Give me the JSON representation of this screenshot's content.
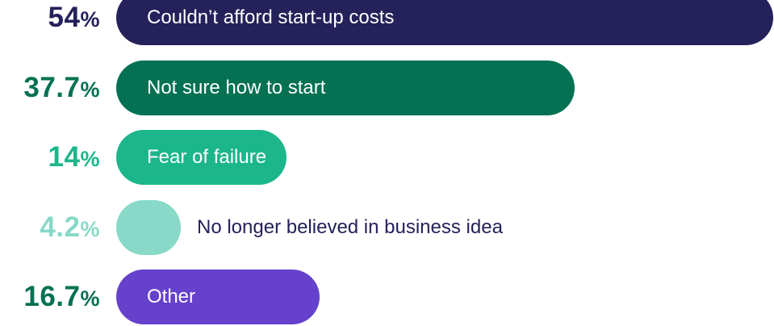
{
  "chart_data": {
    "type": "bar",
    "orientation": "horizontal",
    "categories": [
      "Couldn’t afford start-up costs",
      "Not sure how to start",
      "Fear of failure",
      "No longer believed in business idea",
      "Other"
    ],
    "values": [
      54,
      37.7,
      14,
      4.2,
      16.7
    ],
    "value_labels": [
      "54",
      "37.7",
      "14",
      "4.2",
      "16.7"
    ],
    "unit": "%",
    "colors": [
      "#25215a",
      "#037152",
      "#1cb68b",
      "#88d9c8",
      "#6641cb"
    ],
    "value_label_colors": [
      "#25215a",
      "#037152",
      "#1cb68b",
      "#88d9c8",
      "#037152"
    ],
    "bar_label_colors": [
      "#ffffff",
      "#ffffff",
      "#ffffff",
      "#25215a",
      "#ffffff"
    ],
    "title": "",
    "xlabel": "",
    "ylabel": "",
    "xlim": [
      0,
      54
    ],
    "grid": false,
    "legend": "none"
  }
}
